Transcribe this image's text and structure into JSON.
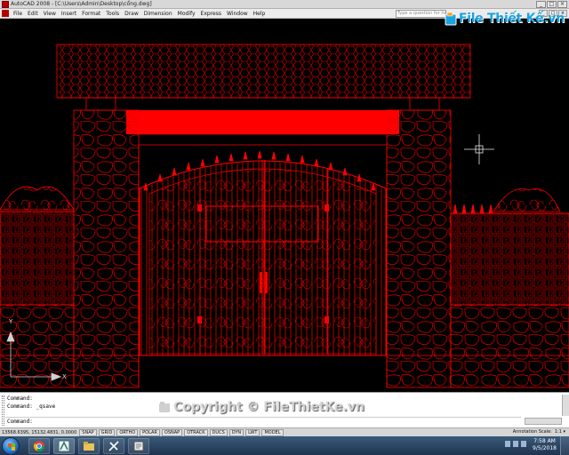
{
  "window": {
    "title": "AutoCAD 2008 - [C:\\Users\\Admin\\Desktop\\cổng.dwg]",
    "controls": [
      "_",
      "□",
      "×"
    ],
    "mdi_controls": [
      "_",
      "□",
      "×"
    ]
  },
  "menu": {
    "items": [
      "File",
      "Edit",
      "View",
      "Insert",
      "Format",
      "Tools",
      "Draw",
      "Dimension",
      "Modify",
      "Express",
      "Window",
      "Help"
    ],
    "help_placeholder": "Type a question for help"
  },
  "watermark": {
    "top_text": "File Thiết Kế.vn",
    "bottom_text": "Copyright © FileThietKe.vn"
  },
  "ucs": {
    "x_label": "X",
    "y_label": "Y"
  },
  "command": {
    "lines": [
      "Command:",
      "Command: _qsave"
    ],
    "prompt": "Command:"
  },
  "status": {
    "coords": "13568.6395, 15132.4831, 0.0000",
    "buttons": [
      "SNAP",
      "GRID",
      "ORTHO",
      "POLAR",
      "OSNAP",
      "OTRACK",
      "DUCS",
      "DYN",
      "LWT",
      "MODEL"
    ],
    "annotation_scale_label": "Annotation Scale:",
    "annotation_scale_value": "1:1 ▾"
  },
  "taskbar": {
    "time": "7:58 AM",
    "date": "9/5/2018"
  },
  "colors": {
    "drawing_line": "#ff0000",
    "drawing_bg": "#000000",
    "watermark": "#1aa3e0"
  }
}
